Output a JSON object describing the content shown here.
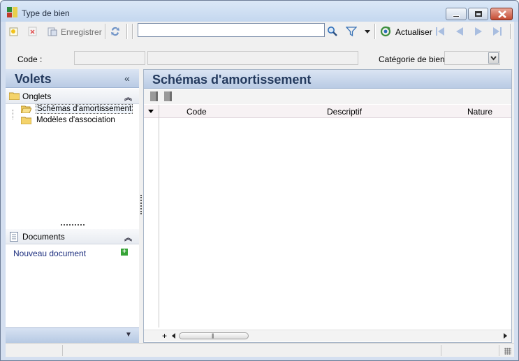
{
  "window": {
    "title": "Type de bien"
  },
  "toolbar": {
    "save_label": "Enregistrer",
    "search_value": "",
    "search_placeholder": "",
    "refresh_label": "Actualiser"
  },
  "form": {
    "code_label": "Code :",
    "code_value": "",
    "description_value": "",
    "category_label": "Catégorie de bien :",
    "category_value": ""
  },
  "left_pane": {
    "title": "Volets",
    "tabs_section": {
      "title": "Onglets",
      "items": [
        {
          "label": "Schémas d'amortissement",
          "selected": true
        },
        {
          "label": "Modèles d'association",
          "selected": false
        }
      ]
    },
    "documents_section": {
      "title": "Documents",
      "new_document_label": "Nouveau document"
    }
  },
  "right_pane": {
    "title": "Schémas d'amortissement",
    "columns": [
      "Code",
      "Descriptif",
      "Nature"
    ]
  },
  "icons": {
    "new": "new-record-icon",
    "delete": "delete-icon",
    "save": "save-icon",
    "refresh": "refresh-arrows-icon",
    "search": "magnifier-icon",
    "filter": "funnel-icon",
    "actualiser": "refresh-circle-icon",
    "first": "first-record-icon",
    "previous": "previous-record-icon",
    "next": "next-record-icon",
    "last": "last-record-icon"
  },
  "colors": {
    "pane_header": "#b9cbe4",
    "pane_title": "#243a5e",
    "link": "#1d2f7f"
  }
}
